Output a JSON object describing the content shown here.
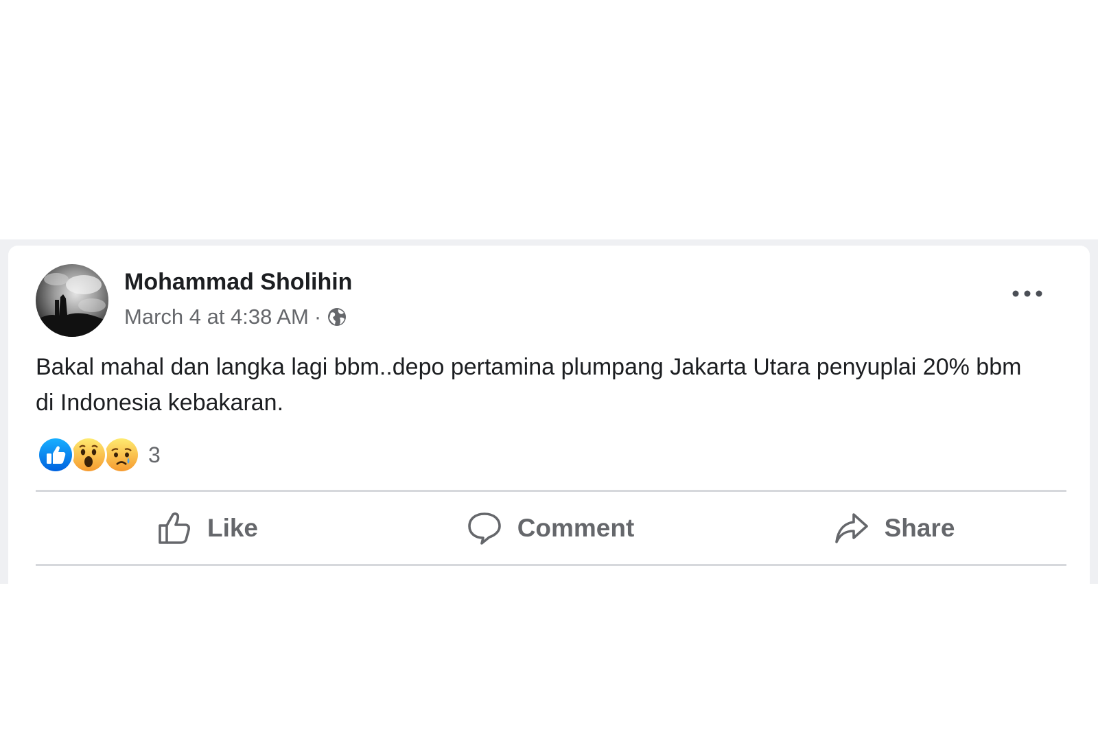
{
  "post": {
    "author": "Mohammad Sholihin",
    "timestamp": "March 4 at 4:38 AM",
    "separator": "·",
    "audience_icon": "globe-icon",
    "text": "Bakal mahal dan langka lagi bbm..depo pertamina plumpang Jakarta Utara penyuplai 20% bbm di Indonesia kebakaran.",
    "reactions": {
      "types": [
        "like-reaction-icon",
        "wow-reaction-icon",
        "sad-reaction-icon"
      ],
      "count": "3"
    },
    "actions": {
      "like_label": "Like",
      "comment_label": "Comment",
      "share_label": "Share"
    },
    "more_icon": "more-options-icon"
  },
  "colors": {
    "text_primary": "#1c1e21",
    "text_secondary": "#65676b",
    "like_blue": "#1877f2",
    "reaction_yellow": "#f7b125",
    "feed_background": "#eff0f3",
    "divider": "#d6d8dc"
  }
}
